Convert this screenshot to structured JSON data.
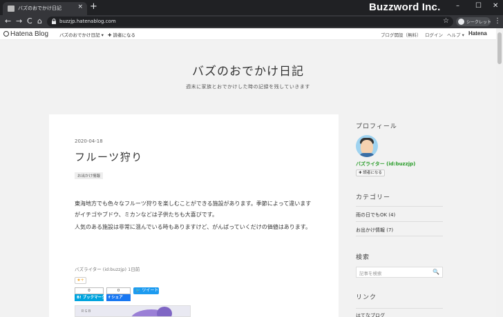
{
  "browser": {
    "tab_title": "バズのおでかけ日記",
    "tab_close": "×",
    "new_tab": "+",
    "watermark": "Buzzword Inc.",
    "url": "buzzjp.hatenablog.com",
    "incognito_label": "シークレット",
    "icons": {
      "back": "←",
      "forward": "→",
      "reload": "C",
      "home": "⌂",
      "star": "☆",
      "menu": "⋮",
      "minimize": "–",
      "maximize": "☐",
      "close": "✕"
    }
  },
  "hatena_bar": {
    "logo": "Hatena Blog",
    "blog_menu": "バズのおでかけ日記 ▾",
    "subscribe": "✚ 読者になる",
    "start_blog": "ブログ開設（無料）",
    "login": "ログイン",
    "help": "ヘルプ ▾",
    "hatena_logo": "Hatena"
  },
  "blog": {
    "title": "バズのおでかけ日記",
    "description": "週末に家族とおでかけした時の記録を残していきます"
  },
  "article": {
    "date": "2020-04-18",
    "title": "フルーツ狩り",
    "category_tag": "お出かけ情報",
    "paragraphs": [
      "東海地方でも色々なフルーツ狩りを楽しむことができる施設があります。季節によって違いますがイチゴやブドウ、ミカンなどは子供たちも大喜びです。",
      "人気のある施設は非常に混んでいる時もありますけど、がんばっていくだけの価値はあります。"
    ],
    "author_line": "バズライター (id:buzzjp) 1日前",
    "star_button": "★+",
    "hatebu_count": "0",
    "hatebu_label": "B! ブックマーク",
    "fb_count": "0",
    "fb_label": "f シェア",
    "tweet_label": "🐦 ツイート",
    "thumb_text": "ＲＧＢ"
  },
  "sidebar": {
    "profile_heading": "プロフィール",
    "username": "バズライター (id:buzzjp)",
    "reader_button": "✚ 読者になる",
    "category_heading": "カテゴリー",
    "categories": [
      "雨の日でもOK (4)",
      "お出かけ情報 (7)"
    ],
    "search_heading": "検索",
    "search_placeholder": "記事を検索",
    "search_icon": "🔍",
    "links_heading": "リンク",
    "links": [
      "はてなブログ"
    ]
  },
  "colors": {
    "chrome_dark": "#202124",
    "chrome_mid": "#35363a",
    "page_bg": "#f2f2f2",
    "username_green": "#2a9d2a",
    "tweet_blue": "#1d9bf0",
    "hatebu_blue": "#00a4de",
    "fb_blue": "#1877f2"
  }
}
